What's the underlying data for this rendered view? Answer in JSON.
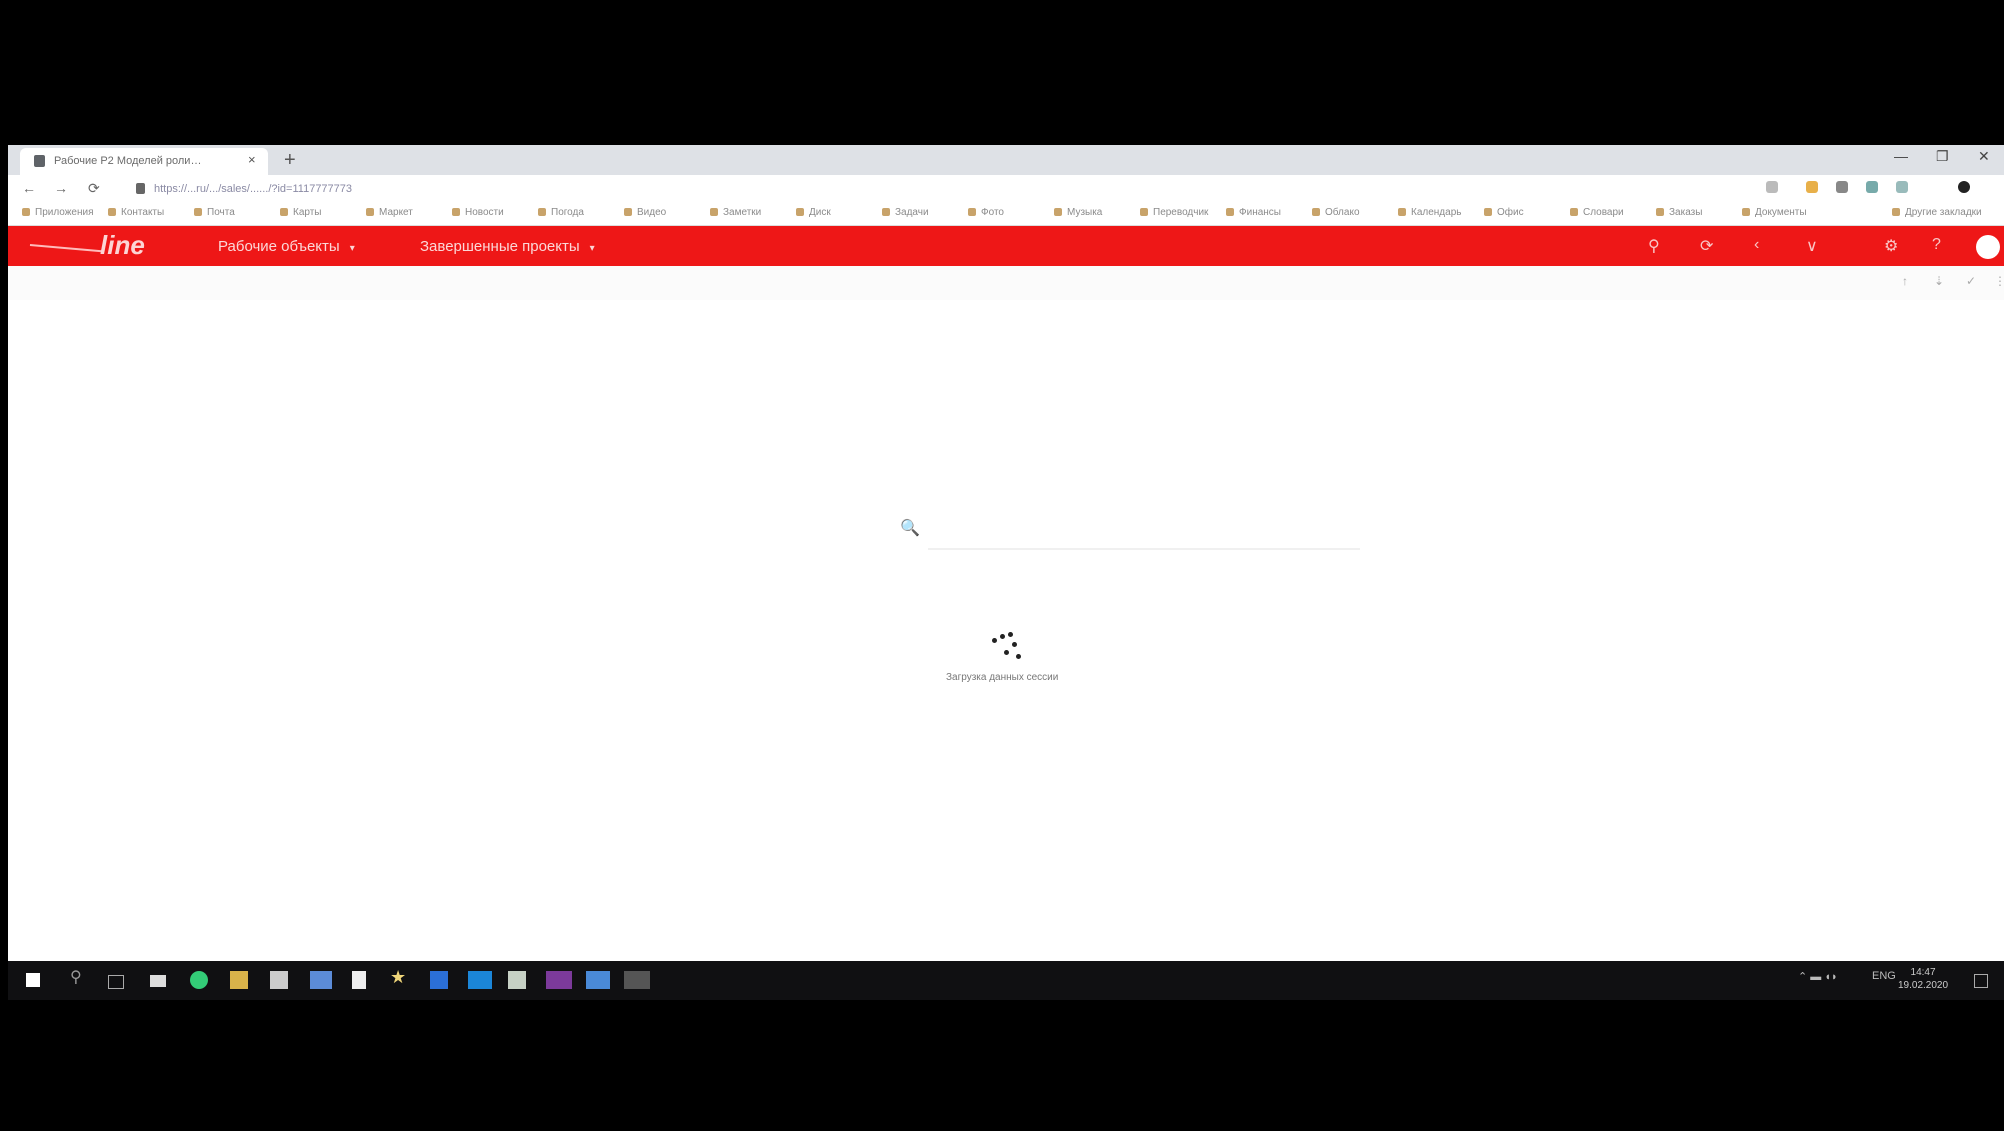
{
  "browser": {
    "tab_title": "Рабочие Р2 Моделей роли…",
    "tab_close": "×",
    "new_tab": "+",
    "window_controls": [
      "—",
      "❐",
      "✕"
    ],
    "url": "https://...ru/.../sales/....../?id=1117777773",
    "nav": [
      "←",
      "→",
      "⟳"
    ],
    "bookmarks": [
      "Приложения",
      "Контакты",
      "Почта",
      "Карты",
      "Маркет",
      "Новости",
      "Погода",
      "Видео",
      "Заметки",
      "Диск",
      "Задачи",
      "Фото",
      "Музыка",
      "Переводчик",
      "Финансы",
      "Облако",
      "Календарь",
      "Офис",
      "Словари",
      "Заказы",
      "Документы",
      "Другие закладки"
    ]
  },
  "app": {
    "logo": "line",
    "menus": [
      {
        "label": "Рабочие объекты"
      },
      {
        "label": "Завершенные проекты"
      }
    ],
    "header_icons": [
      "search-icon",
      "refresh-icon",
      "arrow-icon",
      "filter-icon",
      "settings-icon",
      "help-icon"
    ],
    "toolbar_icons": [
      "pin-icon",
      "bookmark-icon",
      "check-icon",
      "menu-icon"
    ],
    "search": {
      "icon": "🔍"
    },
    "loading_text": "Загрузка данных сессии"
  },
  "taskbar": {
    "tray_text": "ENG",
    "clock_time": "14:47",
    "clock_date": "19.02.2020"
  }
}
